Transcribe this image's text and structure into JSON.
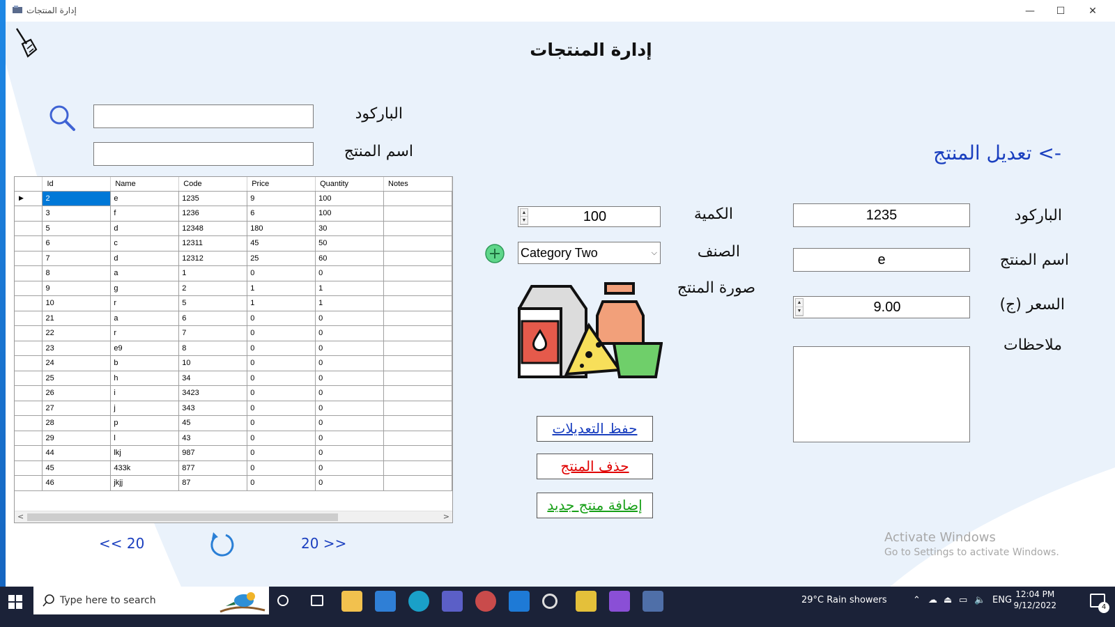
{
  "window": {
    "title": "إدارة المنتجات",
    "minimize": "—",
    "maximize": "☐",
    "close": "✕"
  },
  "page_title": "إدارة المنتجات",
  "search": {
    "barcode_label": "الباركود",
    "barcode_value": "",
    "name_label": "اسم المنتج",
    "name_value": ""
  },
  "grid": {
    "columns": [
      "Id",
      "Name",
      "Code",
      "Price",
      "Quantity",
      "Notes"
    ],
    "rows": [
      [
        "2",
        "e",
        "1235",
        "9",
        "100",
        ""
      ],
      [
        "3",
        "f",
        "1236",
        "6",
        "100",
        ""
      ],
      [
        "5",
        "d",
        "12348",
        "180",
        "30",
        ""
      ],
      [
        "6",
        "c",
        "12311",
        "45",
        "50",
        ""
      ],
      [
        "7",
        "d",
        "12312",
        "25",
        "60",
        ""
      ],
      [
        "8",
        "a",
        "1",
        "0",
        "0",
        ""
      ],
      [
        "9",
        "g",
        "2",
        "1",
        "1",
        ""
      ],
      [
        "10",
        "r",
        "5",
        "1",
        "1",
        ""
      ],
      [
        "21",
        "a",
        "6",
        "0",
        "0",
        ""
      ],
      [
        "22",
        "r",
        "7",
        "0",
        "0",
        ""
      ],
      [
        "23",
        "e9",
        "8",
        "0",
        "0",
        ""
      ],
      [
        "24",
        "b",
        "10",
        "0",
        "0",
        ""
      ],
      [
        "25",
        "h",
        "34",
        "0",
        "0",
        ""
      ],
      [
        "26",
        "i",
        "3423",
        "0",
        "0",
        ""
      ],
      [
        "27",
        "j",
        "343",
        "0",
        "0",
        ""
      ],
      [
        "28",
        "p",
        "45",
        "0",
        "0",
        ""
      ],
      [
        "29",
        "l",
        "43",
        "0",
        "0",
        ""
      ],
      [
        "44",
        "lkj",
        "987",
        "0",
        "0",
        ""
      ],
      [
        "45",
        "433k",
        "877",
        "0",
        "0",
        ""
      ],
      [
        "46",
        "jkjj",
        "87",
        "0",
        "0",
        ""
      ]
    ],
    "current_row_marker": "▶",
    "scroll_left": "<",
    "scroll_right": ">"
  },
  "pager": {
    "prev_label": "<< 20",
    "next_label": "20 >>"
  },
  "edit": {
    "heading": "-> تعديل المنتج",
    "barcode_label": "الباركود",
    "barcode_value": "1235",
    "name_label": "اسم المنتج",
    "name_value": "e",
    "price_label": "السعر (ج)",
    "price_value": "9.00",
    "notes_label": "ملاحظات",
    "notes_value": "",
    "qty_label": "الكمية",
    "qty_value": "100",
    "category_label": "الصنف",
    "category_value": "Category Two",
    "image_label": "صورة المنتج",
    "spin_up": "▲",
    "spin_down": "▼",
    "dropdown_chevron": "⌵"
  },
  "actions": {
    "save": "حفظ التعديلات",
    "delete": "حذف المنتج",
    "add": "إضافة منتج جديد"
  },
  "watermark": {
    "title": "Activate Windows",
    "subtitle": "Go to Settings to activate Windows."
  },
  "taskbar": {
    "search_placeholder": "Type here to search",
    "weather": "29°C  Rain showers",
    "language": "ENG",
    "time": "12:04 PM",
    "date": "9/12/2022",
    "notification_count": "4"
  },
  "colors": {
    "accent_blue": "#1a3fbf",
    "delete_red": "#e00000",
    "add_green": "#18a018",
    "selection": "#0078d7",
    "background_shape": "#eaf2fb"
  }
}
